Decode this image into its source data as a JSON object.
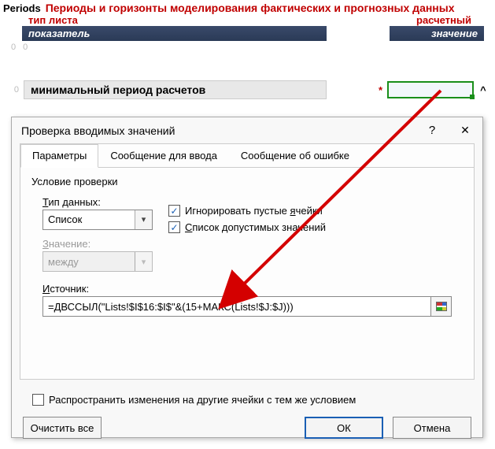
{
  "header": {
    "periods_label": "Periods",
    "periods_desc": "Периоды и горизонты моделирования фактических и прогнозных данных",
    "col_left": "тип листа",
    "col_right": "расчетный",
    "banner_left": "показатель",
    "banner_right": "значение",
    "zeros": "0  0"
  },
  "formula": {
    "row_zero": "0",
    "label": "минимальный период расчетов",
    "star": "*",
    "caret": "^"
  },
  "dialog": {
    "title": "Проверка вводимых значений",
    "help": "?",
    "close": "✕",
    "tabs": {
      "t1": "Параметры",
      "t2": "Сообщение для ввода",
      "t3": "Сообщение об ошибке"
    },
    "section": "Условие проверки",
    "type_label": "Тип данных:",
    "type_underline": "Т",
    "type_value": "Список",
    "val_label": "Значение:",
    "val_underline": "З",
    "val_value": "между",
    "check1_pre": "Игнорировать пустые ",
    "check1_ul": "я",
    "check1_post": "чейки",
    "check2_pre": "",
    "check2_ul": "С",
    "check2_post": "писок допустимых значений",
    "src_pre": "",
    "src_ul": "И",
    "src_post": "сточник:",
    "src_value": "=ДВССЫЛ(\"Lists!$I$16:$I$\"&(15+МАКС(Lists!$J:$J)))",
    "propagate": "Распространить изменения на другие ячейки с тем же условием",
    "clear": "Очистить все",
    "ok": "ОК",
    "cancel": "Отмена"
  }
}
